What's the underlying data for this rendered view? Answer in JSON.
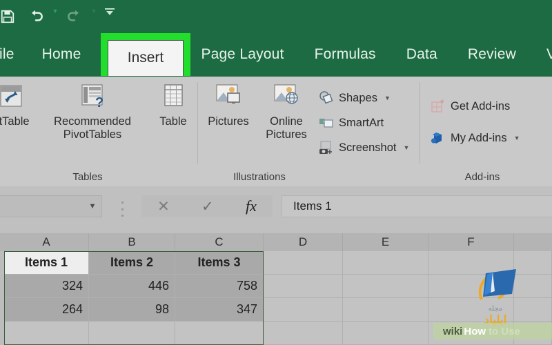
{
  "colors": {
    "ribbon_green": "#1d6b42",
    "highlight_green": "#22dd2b",
    "ribbon_grey": "#c9c9c9",
    "grid_grey": "#bdbdbd",
    "selection_border": "#36603f"
  },
  "quick_access": {
    "items": [
      {
        "name": "save-icon",
        "label": "Save",
        "disabled": false
      },
      {
        "name": "undo-icon",
        "label": "Undo",
        "disabled": false
      },
      {
        "name": "redo-icon",
        "label": "Redo",
        "disabled": true
      },
      {
        "name": "customize-quick-access-icon",
        "label": "Customize Quick Access Toolbar",
        "disabled": false
      }
    ]
  },
  "tabs": {
    "items": [
      {
        "label": "File",
        "active": false,
        "clipped": true
      },
      {
        "label": "Home",
        "active": false,
        "clipped": false
      },
      {
        "label": "Insert",
        "active": true,
        "clipped": false
      },
      {
        "label": "Page Layout",
        "active": false,
        "clipped": false
      },
      {
        "label": "Formulas",
        "active": false,
        "clipped": false
      },
      {
        "label": "Data",
        "active": false,
        "clipped": false
      },
      {
        "label": "Review",
        "active": false,
        "clipped": false
      },
      {
        "label": "View",
        "active": false,
        "clipped": true
      }
    ],
    "highlighted": "Insert"
  },
  "ribbon": {
    "groups": [
      {
        "title": "Tables",
        "buttons": [
          {
            "label": "otTable",
            "full_label": "PivotTable",
            "icon": "pivottable-icon"
          },
          {
            "label": "Recommended\nPivotTables",
            "line1": "Recommended",
            "line2": "PivotTables",
            "icon": "recommended-pivottables-icon"
          },
          {
            "label": "Table",
            "icon": "table-icon"
          }
        ]
      },
      {
        "title": "Illustrations",
        "buttons": [
          {
            "label": "Pictures",
            "icon": "pictures-icon"
          },
          {
            "line1": "Online",
            "line2": "Pictures",
            "icon": "online-pictures-icon"
          }
        ],
        "small_buttons": [
          {
            "label": "Shapes",
            "icon": "shapes-icon",
            "has_dropdown": true
          },
          {
            "label": "SmartArt",
            "icon": "smartart-icon",
            "has_dropdown": false
          },
          {
            "label": "Screenshot",
            "icon": "screenshot-icon",
            "has_dropdown": true
          }
        ]
      },
      {
        "title": "Add-ins",
        "small_buttons": [
          {
            "label": "Get Add-ins",
            "icon": "get-add-ins-icon",
            "has_dropdown": false
          },
          {
            "label": "My Add-ins",
            "icon": "my-add-ins-icon",
            "has_dropdown": true
          }
        ]
      }
    ]
  },
  "formula_bar": {
    "name_box_value": "",
    "name_box_placeholder": "",
    "cancel_label": "✕",
    "enter_label": "✓",
    "function_label": "fx",
    "value": "Items 1"
  },
  "sheet": {
    "columns": [
      "A",
      "B",
      "C",
      "D",
      "E",
      "F"
    ],
    "rows": [
      [
        "Items 1",
        "Items 2",
        "Items 3",
        "",
        "",
        ""
      ],
      [
        "324",
        "446",
        "758",
        "",
        "",
        ""
      ],
      [
        "264",
        "98",
        "347",
        "",
        "",
        ""
      ]
    ],
    "selected_range": "A1:C3",
    "active_cell": "A1",
    "active_cell_value": "Items 1"
  },
  "watermark": {
    "arabic_small": "مجله",
    "arabic_large": "ایلیاد",
    "wiki_part1": "wiki",
    "wiki_part2": "How",
    "wiki_part3": "to Use"
  }
}
